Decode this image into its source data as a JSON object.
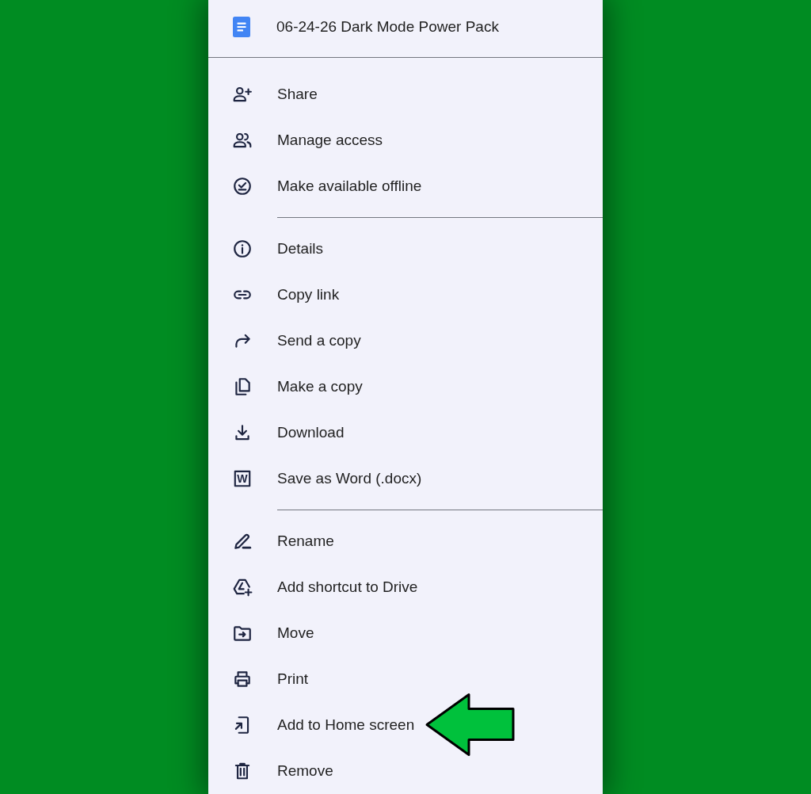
{
  "document": {
    "title": "06-24-26 Dark Mode Power Pack"
  },
  "sections": [
    {
      "items": [
        {
          "label": "Share",
          "highlighted": false
        },
        {
          "label": "Manage access",
          "highlighted": false
        },
        {
          "label": "Make available offline",
          "highlighted": false
        }
      ]
    },
    {
      "items": [
        {
          "label": "Details",
          "highlighted": false
        },
        {
          "label": "Copy link",
          "highlighted": false
        },
        {
          "label": "Send a copy",
          "highlighted": false
        },
        {
          "label": "Make a copy",
          "highlighted": false
        },
        {
          "label": "Download",
          "highlighted": false
        },
        {
          "label": "Save as Word (.docx)",
          "highlighted": false,
          "icon_letter": "W"
        }
      ]
    },
    {
      "items": [
        {
          "label": "Rename",
          "highlighted": false
        },
        {
          "label": "Add shortcut to Drive",
          "highlighted": false
        },
        {
          "label": "Move",
          "highlighted": false
        },
        {
          "label": "Print",
          "highlighted": false
        },
        {
          "label": "Add to Home screen",
          "highlighted": true
        },
        {
          "label": "Remove",
          "highlighted": false
        }
      ]
    }
  ]
}
